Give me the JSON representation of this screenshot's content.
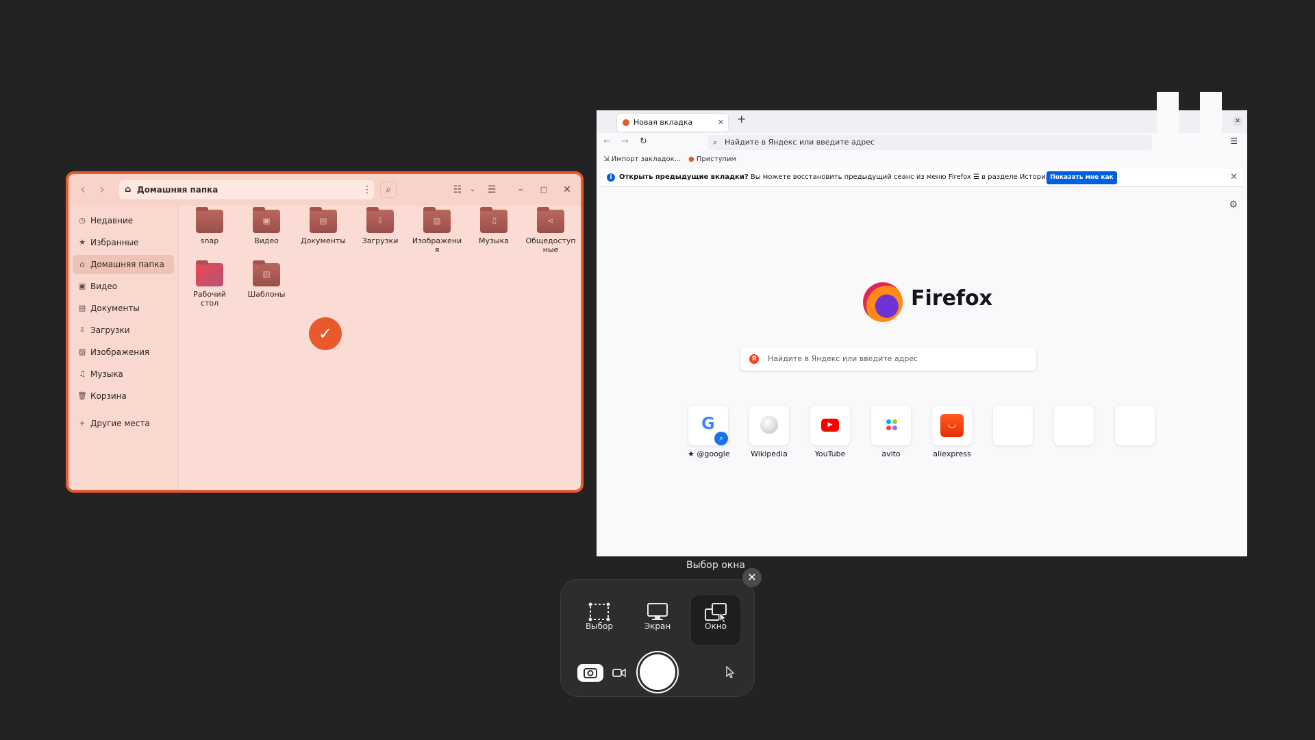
{
  "file_manager": {
    "path": "Домашняя папка",
    "sidebar": [
      {
        "label": "Недавние",
        "icon": "clock-icon"
      },
      {
        "label": "Избранные",
        "icon": "star-icon"
      },
      {
        "label": "Домашняя папка",
        "icon": "home-icon",
        "active": true
      },
      {
        "label": "Видео",
        "icon": "video-icon"
      },
      {
        "label": "Документы",
        "icon": "document-icon"
      },
      {
        "label": "Загрузки",
        "icon": "download-icon"
      },
      {
        "label": "Изображения",
        "icon": "image-icon"
      },
      {
        "label": "Музыка",
        "icon": "music-icon"
      },
      {
        "label": "Корзина",
        "icon": "trash-icon"
      },
      {
        "label": "Другие места",
        "icon": "plus-icon"
      }
    ],
    "folders": [
      {
        "label": "snap",
        "icon": "folder-icon"
      },
      {
        "label": "Видео",
        "icon": "video-folder-icon"
      },
      {
        "label": "Документы",
        "icon": "documents-folder-icon"
      },
      {
        "label": "Загрузки",
        "icon": "downloads-folder-icon"
      },
      {
        "label": "Изображения",
        "icon": "pictures-folder-icon"
      },
      {
        "label": "Музыка",
        "icon": "music-folder-icon"
      },
      {
        "label": "Общедоступные",
        "icon": "share-folder-icon"
      },
      {
        "label": "Рабочий стол",
        "icon": "desktop-folder-icon"
      },
      {
        "label": "Шаблоны",
        "icon": "templates-folder-icon"
      }
    ],
    "accent": "#e8592d"
  },
  "firefox": {
    "tab_title": "Новая вкладка",
    "url_placeholder": "Найдите в Яндекс или введите адрес",
    "bookmarks": [
      {
        "label": "Импорт закладок..."
      },
      {
        "label": "Приступим"
      }
    ],
    "infobar": {
      "bold": "Открыть предыдущие вкладки?",
      "text": "Вы можете восстановить предыдущий сеанс из меню Firefox ☰ в разделе История.",
      "button": "Показать мне как"
    },
    "brand": "Firefox",
    "search_placeholder": "Найдите в Яндекс или введите адрес",
    "shortcuts": [
      {
        "label": "★ @google"
      },
      {
        "label": "Wikipedia"
      },
      {
        "label": "YouTube"
      },
      {
        "label": "avito"
      },
      {
        "label": "aliexpress"
      }
    ]
  },
  "screenshot_tool": {
    "tooltip": "Выбор окна",
    "modes": [
      {
        "label": "Выбор",
        "icon": "selection-icon"
      },
      {
        "label": "Экран",
        "icon": "screen-icon"
      },
      {
        "label": "Окно",
        "icon": "window-icon",
        "active": true
      }
    ]
  }
}
